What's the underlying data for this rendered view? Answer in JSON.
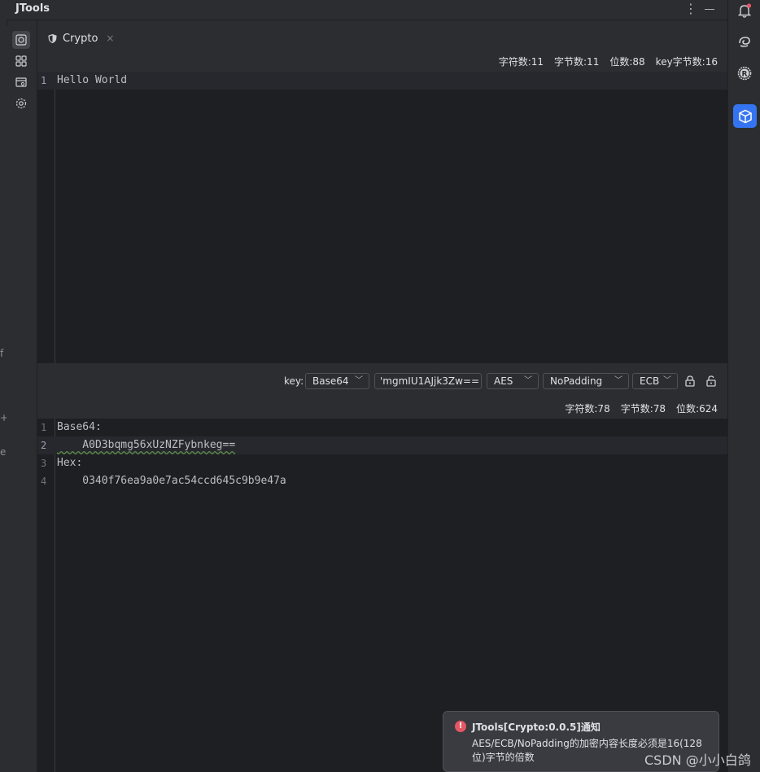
{
  "app": {
    "title": "JTools"
  },
  "tab": {
    "label": "Crypto",
    "close": "×"
  },
  "input_stats": [
    "字符数:11",
    "字节数:11",
    "位数:88",
    "key字节数:16"
  ],
  "input_editor": {
    "lines": [
      {
        "num": "1",
        "text": "Hello World"
      }
    ]
  },
  "controls": {
    "key_label": "key:",
    "key_format": "Base64",
    "key_value": "'mgmIU1AJjk3Zw==",
    "algorithm": "AES",
    "padding": "NoPadding",
    "mode": "ECB",
    "icons": [
      "lock-icon",
      "unlock-icon"
    ]
  },
  "output_stats": [
    "字符数:78",
    "字节数:78",
    "位数:624"
  ],
  "output_editor": {
    "lines": [
      {
        "num": "1",
        "text": "Base64:"
      },
      {
        "num": "2",
        "text": "    A0D3bqmg56xUzNZFybnkeg=="
      },
      {
        "num": "3",
        "text": "Hex:"
      },
      {
        "num": "4",
        "text": "    0340f76ea9a0e7ac54ccd645c9b9e47a"
      }
    ]
  },
  "notification": {
    "title": "JTools[Crypto:0.0.5]通知",
    "body": "AES/ECB/NoPadding的加密内容长度必须是16(128位)字节的倍数",
    "icon": "error-icon"
  },
  "watermark": "CSDN @小小白鸽",
  "edge_glyphs": [
    "f",
    "+",
    "e"
  ],
  "colors": {
    "accent": "#3574f0",
    "error": "#e55765",
    "editor_bg": "#1e1f22",
    "panel_bg": "#2b2d30"
  }
}
